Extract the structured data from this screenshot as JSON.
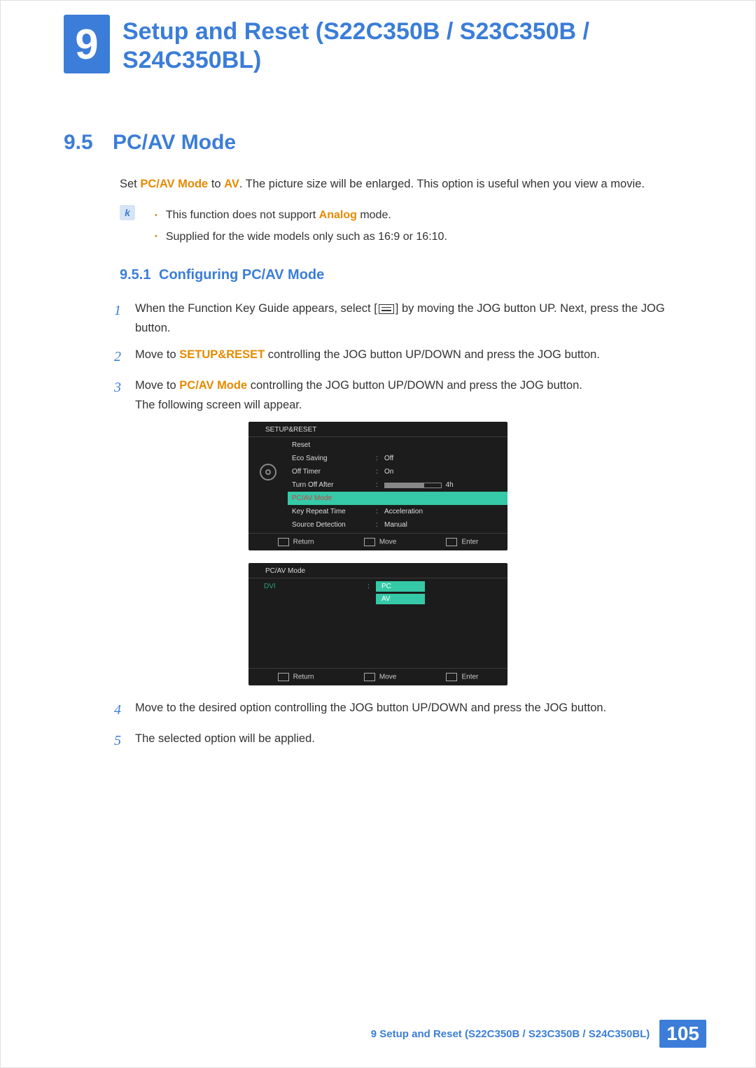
{
  "chapter": {
    "number": "9",
    "title": "Setup and Reset (S22C350B / S23C350B / S24C350BL)"
  },
  "section": {
    "number": "9.5",
    "title": "PC/AV Mode"
  },
  "intro": {
    "t1": "Set ",
    "t2": "PC/AV Mode",
    "t3": " to ",
    "t4": "AV",
    "t5": ". The picture size will be enlarged. This option is useful when you view a movie."
  },
  "notes": {
    "n1a": "This function does not support ",
    "n1b": "Analog",
    "n1c": " mode.",
    "n2": "Supplied for the wide models only such as 16:9 or 16:10."
  },
  "subsection": {
    "number": "9.5.1",
    "title": "Configuring PC/AV Mode"
  },
  "steps": {
    "s1": {
      "num": "1",
      "a": "When the Function Key Guide appears, select [",
      "b": "] by moving the JOG button UP. Next, press the JOG button."
    },
    "s2": {
      "num": "2",
      "a": "Move to ",
      "b": "SETUP&RESET",
      "c": " controlling the JOG button UP/DOWN and press the JOG button."
    },
    "s3": {
      "num": "3",
      "a": "Move to ",
      "b": "PC/AV Mode",
      "c": " controlling the JOG button UP/DOWN and press the JOG button.",
      "d": "The following screen will appear."
    },
    "s4": {
      "num": "4",
      "a": "Move to the desired option controlling the JOG button UP/DOWN and press the JOG button."
    },
    "s5": {
      "num": "5",
      "a": "The selected option will be applied."
    }
  },
  "osd1": {
    "title": "SETUP&RESET",
    "rows": {
      "reset": "Reset",
      "eco_l": "Eco Saving",
      "eco_v": "Off",
      "off_l": "Off Timer",
      "off_v": "On",
      "toa_l": "Turn Off After",
      "toa_v": "4h",
      "pcav": "PC/AV Mode",
      "krt_l": "Key Repeat Time",
      "krt_v": "Acceleration",
      "sd_l": "Source Detection",
      "sd_v": "Manual"
    },
    "footer": {
      "return": "Return",
      "move": "Move",
      "enter": "Enter"
    }
  },
  "osd2": {
    "title": "PC/AV Mode",
    "dvi": "DVI",
    "pc": "PC",
    "av": "AV",
    "footer": {
      "return": "Return",
      "move": "Move",
      "enter": "Enter"
    }
  },
  "footer": {
    "chapter_ref": "9 Setup and Reset (S22C350B / S23C350B / S24C350BL)",
    "page": "105"
  }
}
